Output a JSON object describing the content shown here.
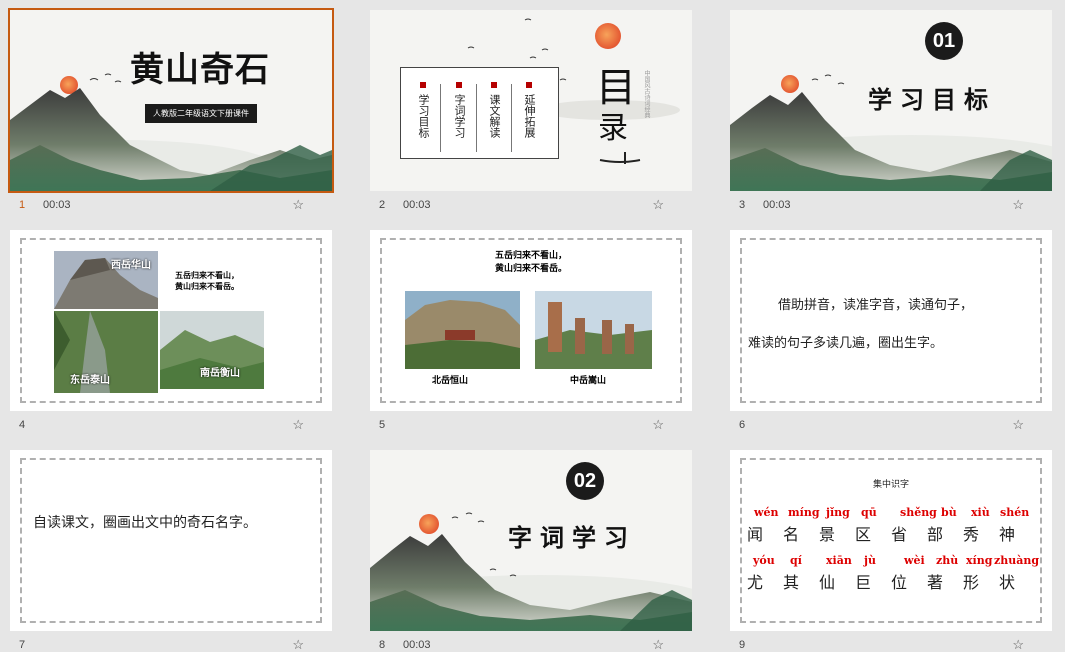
{
  "slides": [
    {
      "num": "1",
      "time": "00:03",
      "title": "黄山奇石",
      "subtitle": "人教版二年级语文下册课件"
    },
    {
      "num": "2",
      "time": "00:03",
      "menu": [
        "学习目标",
        "字词学习",
        "课文解读",
        "延伸拓展"
      ],
      "title_a": "目",
      "title_b": "录",
      "side_text": "中国风古诗词经典"
    },
    {
      "num": "3",
      "time": "00:03",
      "badge": "01",
      "title": "学习目标"
    },
    {
      "num": "4",
      "time": "",
      "labels": {
        "west": "西岳华山",
        "east": "东岳泰山",
        "south": "南岳衡山"
      },
      "poem": [
        "五岳归来不看山，",
        "黄山归来不看岳。"
      ]
    },
    {
      "num": "5",
      "time": "",
      "poem": [
        "五岳归来不看山，",
        "黄山归来不看岳。"
      ],
      "labels": {
        "north": "北岳恒山",
        "center": "中岳嵩山"
      }
    },
    {
      "num": "6",
      "time": "",
      "lines": [
        "借助拼音，读准字音，读通句子，",
        "难读的句子多读几遍，圈出生字。"
      ]
    },
    {
      "num": "7",
      "time": "",
      "text": "自读课文，圈画出文中的奇石名字。"
    },
    {
      "num": "8",
      "time": "00:03",
      "badge": "02",
      "title": "字词学习"
    },
    {
      "num": "9",
      "time": "",
      "heading": "集中识字",
      "row1": [
        {
          "py": "wén",
          "hz": "闻"
        },
        {
          "py": "míng",
          "hz": "名"
        },
        {
          "py": "jǐng",
          "hz": "景"
        },
        {
          "py": "qū",
          "hz": "区"
        },
        {
          "py": "shěng",
          "hz": "省"
        },
        {
          "py": "bù",
          "hz": "部"
        },
        {
          "py": "xiù",
          "hz": "秀"
        },
        {
          "py": "shén",
          "hz": "神"
        }
      ],
      "row2": [
        {
          "py": "yóu",
          "hz": "尤"
        },
        {
          "py": "qí",
          "hz": "其"
        },
        {
          "py": "xiān",
          "hz": "仙"
        },
        {
          "py": "jù",
          "hz": "巨"
        },
        {
          "py": "wèi",
          "hz": "位"
        },
        {
          "py": "zhù",
          "hz": "著"
        },
        {
          "py": "xíng",
          "hz": "形"
        },
        {
          "py": "zhuàng",
          "hz": "状"
        }
      ]
    }
  ],
  "star_icon": "star-icon",
  "colors": {
    "accent": "#c55a11",
    "pinyin": "#dd0000",
    "sun": "#e8623a"
  }
}
